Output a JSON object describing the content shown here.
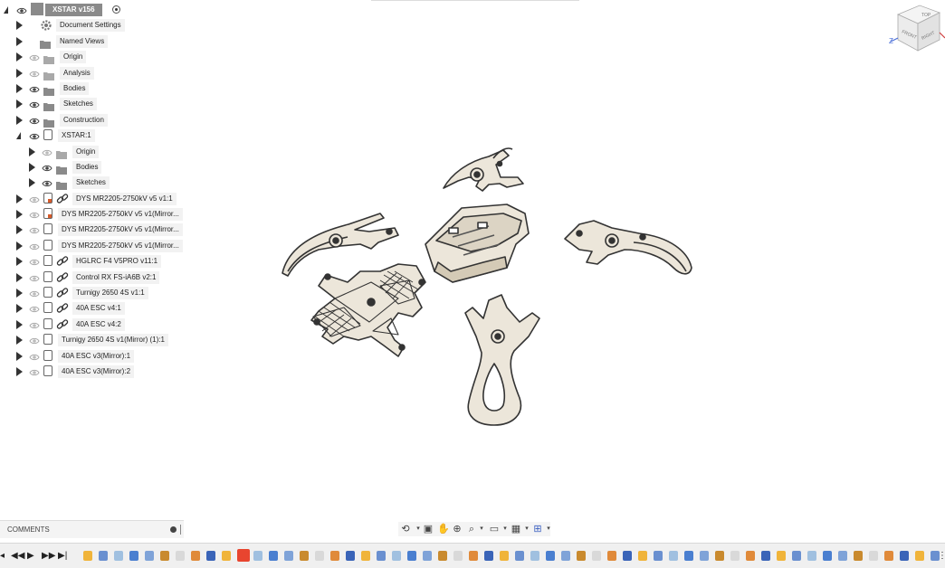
{
  "browser": {
    "root_label": "XSTAR v156",
    "items": [
      {
        "label": "Document Settings"
      },
      {
        "label": "Named Views"
      },
      {
        "label": "Origin"
      },
      {
        "label": "Analysis"
      },
      {
        "label": "Bodies"
      },
      {
        "label": "Sketches"
      },
      {
        "label": "Construction"
      },
      {
        "label": "XSTAR:1"
      },
      {
        "label": "Origin"
      },
      {
        "label": "Bodies"
      },
      {
        "label": "Sketches"
      },
      {
        "label": "DYS MR2205-2750kV v5 v1:1"
      },
      {
        "label": "DYS MR2205-2750kV v5 v1(Mirror..."
      },
      {
        "label": "DYS MR2205-2750kV v5 v1(Mirror..."
      },
      {
        "label": "DYS MR2205-2750kV v5 v1(Mirror..."
      },
      {
        "label": "HGLRC F4 V5PRO v11:1"
      },
      {
        "label": "Control RX FS-iA6B v2:1"
      },
      {
        "label": "Turnigy 2650 4S v1:1"
      },
      {
        "label": "40A ESC v4:1"
      },
      {
        "label": "40A ESC v4:2"
      },
      {
        "label": "Turnigy 2650 4S v1(Mirror) (1):1"
      },
      {
        "label": "40A ESC v3(Mirror):1"
      },
      {
        "label": "40A ESC v3(Mirror):2"
      }
    ]
  },
  "comments": {
    "label": "COMMENTS"
  },
  "viewcube": {
    "top": "TOP",
    "front": "FRONT",
    "right": "RIGHT",
    "axis_z": "Z"
  },
  "colors": {
    "part_fill": "#ece6da",
    "part_stroke": "#333333",
    "accent": "#e8452f"
  }
}
